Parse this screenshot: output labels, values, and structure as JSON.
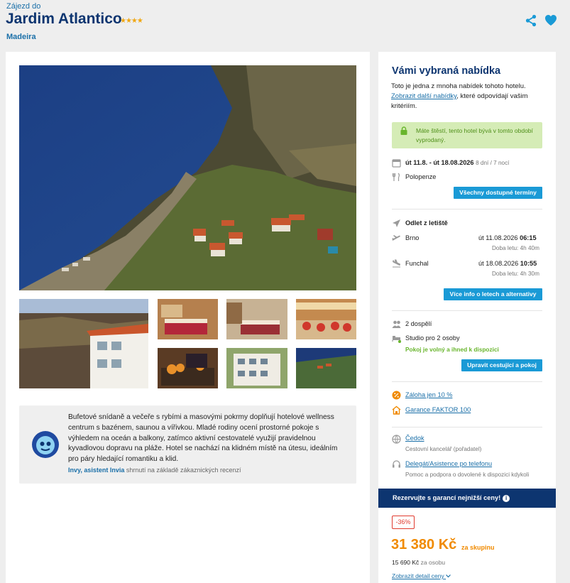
{
  "header": {
    "subtitle": "Zájezd do",
    "title": "Jardim Atlantico",
    "stars": "★★★★",
    "destination": "Madeira"
  },
  "review": {
    "text": "Bufetové snídaně a večeře s rybími a masovými pokrmy doplňují hotelové wellness centrum s bazénem, saunou a vířivkou. Mladé rodiny ocení prostorné pokoje s výhledem na oceán a balkony, zatímco aktivní cestovatelé využijí pravidelnou kyvadlovou dopravu na pláže. Hotel se nachází na klidném místě na útesu, ideálním pro páry hledající romantiku a klid.",
    "author": "Invy, asistent Invia",
    "author_note": "shrnutí na základě zákaznických recenzí"
  },
  "offer": {
    "title": "Vámi vybraná nabídka",
    "intro_text": "Toto je jedna z mnoha nabídek tohoto hotelu.",
    "intro_link": "Zobrazit další nabídky",
    "intro_rest": ", které odpovídají vašim kritériím.",
    "lucky": "Máte štěstí, tento hotel bývá v tomto období vyprodaný.",
    "dates": "út 11.8. - út 18.08.2026",
    "duration": "8 dní / 7 nocí",
    "board": "Polopenze",
    "all_dates_button": "Všechny dostupné termíny",
    "flight_title": "Odlet z letiště",
    "outbound": {
      "city": "Brno",
      "date": "út 11.08.2026",
      "time": "06:15",
      "duration": "Doba letu: 4h 40m"
    },
    "inbound": {
      "city": "Funchal",
      "date": "út 18.08.2026",
      "time": "10:55",
      "duration": "Doba letu: 4h 30m"
    },
    "flight_button": "Více info o letech a alternativy",
    "travelers": "2 dospělí",
    "room": "Studio pro 2 osoby",
    "room_status": "Pokoj je volný a ihned k dispozici",
    "edit_button": "Upravit cestující a pokoj",
    "deposit": "Záloha jen 10 %",
    "guarantee": "Garance FAKTOR 100",
    "agency": "Čedok",
    "agency_note": "Cestovní kancelář (pořadatel)",
    "support": "Delegát/Asistence po telefonu",
    "support_note": "Pomoc a podpora o dovolené k dispozici kdykoli",
    "banner": "Rezervujte s garancí nejnižší ceny!",
    "discount": "-36%",
    "price": "31 380 Kč",
    "price_suffix": "za skupinu",
    "price_pp": "15 690 Kč",
    "price_pp_suffix": "za osobu",
    "detail_link": "Zobrazit detail ceny"
  },
  "colors": {
    "brand_dark": "#0d3570",
    "link": "#1a6fa8",
    "button": "#1a9ad6",
    "price": "#f08a00",
    "success": "#68b52c",
    "lucky_bg": "#d5ecb6"
  },
  "icons": [
    "share-icon",
    "heart-icon",
    "lock-icon",
    "calendar-icon",
    "utensils-icon",
    "plane-icon",
    "takeoff-icon",
    "landing-icon",
    "people-icon",
    "bed-icon",
    "percent-icon",
    "shield-icon",
    "agency-icon",
    "headset-icon",
    "info-icon",
    "chevron-down-icon"
  ]
}
